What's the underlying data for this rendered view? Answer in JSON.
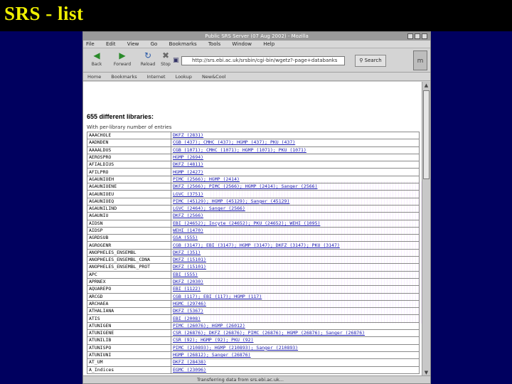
{
  "slide": {
    "title": "SRS - list"
  },
  "browser": {
    "window_title": "Public SRS Server (07 Aug 2002) - Mozilla",
    "menu": [
      "File",
      "Edit",
      "View",
      "Go",
      "Bookmarks",
      "Tools",
      "Window",
      "Help"
    ],
    "toolbar": {
      "back": "Back",
      "forward": "Forward",
      "reload": "Reload",
      "stop": "Stop",
      "url": "http://srs.ebi.ac.uk/srsbin/cgi-bin/wgetz?-page+databanks",
      "search": "Search"
    },
    "personal_bar": [
      "Home",
      "Bookmarks",
      "Internet",
      "Lookup",
      "New&Cool"
    ],
    "status_text": "Transferring data from srs.ebi.ac.uk..."
  },
  "page": {
    "heading": "655 different libraries:",
    "subheading": "With per-library number of entries",
    "libraries": [
      {
        "name": "AAACHOLE",
        "entries": "DKFZ (2831)"
      },
      {
        "name": "AADNDEN",
        "entries": "CGB (437); CMHC (437); HGMP (437); PKU (437)"
      },
      {
        "name": "AAAALDUS",
        "entries": "CGB (1071); CMHC (1071); HGMP (1071); PKU (1071)"
      },
      {
        "name": "AEROSPRO",
        "entries": "HGMP (2694)"
      },
      {
        "name": "AFIALDIUS",
        "entries": "DKFZ (4811)"
      },
      {
        "name": "AFILPRO",
        "entries": "HGMP (2427)"
      },
      {
        "name": "AGAUNIOEH",
        "entries": "PIMC (2566); HGMP (2414)"
      },
      {
        "name": "AGAUNIOENE",
        "entries": "DKFZ (2566); PIMC (2566); HGMP (2414); Sanger (2566)"
      },
      {
        "name": "AGAUNIOEU",
        "entries": "LGVC (3751)"
      },
      {
        "name": "AGAUNIOEQ",
        "entries": "PIMC (45129); HGMP (45129); Sanger (45129)"
      },
      {
        "name": "AGAUNILIND",
        "entries": "LGVC (2464); Sanger (2566)"
      },
      {
        "name": "AGAUNIU",
        "entries": "DKFZ (2566)"
      },
      {
        "name": "AIDSN",
        "entries": "EBI (24652); Incyte (24652); PKU (24652); WEHI (1095)"
      },
      {
        "name": "AIDSP",
        "entries": "WEHI (1470)"
      },
      {
        "name": "AGRDSUB",
        "entries": "GSA (555)"
      },
      {
        "name": "AGROGENR",
        "entries": "CGB (3147); EBI (3147); HGMP (3147); DKFZ (3147); PKU (3147)"
      },
      {
        "name": "ANOPHELES_ENSEMBL",
        "entries": "DKFZ (351)"
      },
      {
        "name": "ANOPHELES_ENSEMBL_CDNA",
        "entries": "DKFZ (15101)"
      },
      {
        "name": "ANOPHELES_ENSEMBL_PROT",
        "entries": "DKFZ (15101)"
      },
      {
        "name": "APC",
        "entries": "EBI (555)"
      },
      {
        "name": "APRNEX",
        "entries": "DKFZ (2030)"
      },
      {
        "name": "AQUAREPO",
        "entries": "EBI (1122)"
      },
      {
        "name": "ARCGD",
        "entries": "CGB (117); EBI (117); HGMP (117)"
      },
      {
        "name": "ARCHAEA",
        "entries": "HGMC (29746)"
      },
      {
        "name": "ATHALIANA",
        "entries": "DKFZ (5367)"
      },
      {
        "name": "ATIS",
        "entries": "EBI (2008)"
      },
      {
        "name": "ATUNIGEN",
        "entries": "PIMC (26076); HGMP (26012)"
      },
      {
        "name": "ATUNIGENE",
        "entries": "CSR (26876); DKFZ (26876); PIMC (26876); HGMP (26876); Sanger (26876)"
      },
      {
        "name": "ATUNILIB",
        "entries": "CSR (92); HGMP (92); PKU (92)"
      },
      {
        "name": "ATUNISPO",
        "entries": "PIMC (210893); HGMP (210893); Sanger (210893)"
      },
      {
        "name": "ATUNIUNI",
        "entries": "HGMP (26812); Sanger (26876)"
      },
      {
        "name": "AT_UM",
        "entries": "DKFZ (28438)"
      },
      {
        "name": "A_Indices",
        "entries": "EGMC (23096)"
      }
    ]
  },
  "colors": {
    "slide_background": "#00005f",
    "title": "#f0f000",
    "link": "#1a1ab0"
  }
}
